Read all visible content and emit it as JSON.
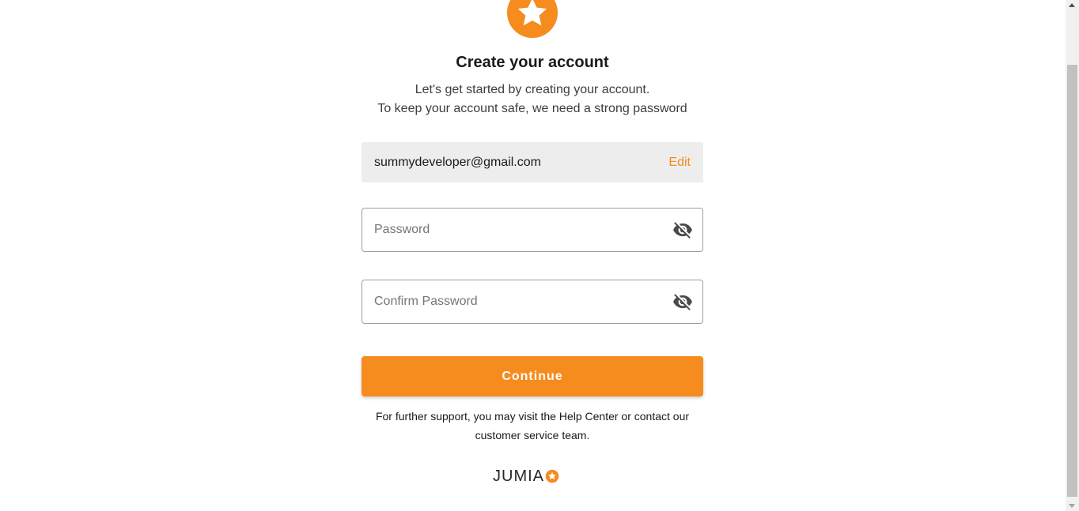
{
  "header": {
    "title": "Create your account",
    "subtitle_line1": "Let's get started by creating your account.",
    "subtitle_line2": "To keep your account safe, we need a strong password"
  },
  "email": {
    "value": "summydeveloper@gmail.com",
    "edit_label": "Edit"
  },
  "password": {
    "placeholder": "Password",
    "value": "",
    "toggle_icon": "eye-off-icon"
  },
  "confirm_password": {
    "placeholder": "Confirm Password",
    "value": "",
    "toggle_icon": "eye-off-icon"
  },
  "continue_label": "Continue",
  "support_text": "For further support, you may visit the Help Center or contact our customer service team.",
  "brand": {
    "name": "JUMIA",
    "logo_icon": "star-icon"
  },
  "colors": {
    "accent": "#f68b1e",
    "email_bg": "#ededed",
    "border": "#9e9e9e"
  }
}
